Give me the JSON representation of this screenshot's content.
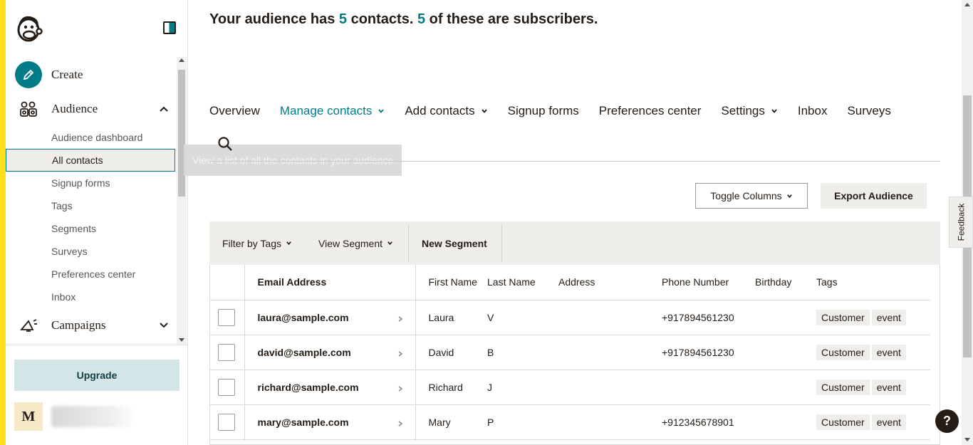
{
  "sidebar": {
    "create_label": "Create",
    "audience_label": "Audience",
    "campaigns_label": "Campaigns",
    "audience_items": [
      {
        "label": "Audience dashboard"
      },
      {
        "label": "All contacts"
      },
      {
        "label": "Signup forms"
      },
      {
        "label": "Tags"
      },
      {
        "label": "Segments"
      },
      {
        "label": "Surveys"
      },
      {
        "label": "Preferences center"
      },
      {
        "label": "Inbox"
      }
    ],
    "upgrade_label": "Upgrade",
    "account_initial": "M"
  },
  "tooltip": {
    "text": "View a list of all the contacts in your audience."
  },
  "headline": {
    "prefix": "Your audience has ",
    "contacts_count": "5",
    "middle": " contacts. ",
    "subscribers_count": "5",
    "suffix": " of these are subscribers."
  },
  "tabs": [
    {
      "label": "Overview"
    },
    {
      "label": "Manage contacts"
    },
    {
      "label": "Add contacts"
    },
    {
      "label": "Signup forms"
    },
    {
      "label": "Preferences center"
    },
    {
      "label": "Settings"
    },
    {
      "label": "Inbox"
    },
    {
      "label": "Surveys"
    }
  ],
  "toolbar": {
    "toggle_columns_label": "Toggle Columns",
    "export_label": "Export Audience",
    "filter_tags_label": "Filter by Tags",
    "view_segment_label": "View Segment",
    "new_segment_label": "New Segment"
  },
  "table": {
    "headers": {
      "email": "Email Address",
      "first": "First Name",
      "last": "Last Name",
      "address": "Address",
      "phone": "Phone Number",
      "birthday": "Birthday",
      "tags": "Tags"
    },
    "rows": [
      {
        "email": "laura@sample.com",
        "first": "Laura",
        "last": "V",
        "address": "",
        "phone": "+917894561230",
        "birthday": "",
        "tag1": "Customer",
        "tag2": "event"
      },
      {
        "email": "david@sample.com",
        "first": "David",
        "last": "B",
        "address": "",
        "phone": "+917894561230",
        "birthday": "",
        "tag1": "Customer",
        "tag2": "event"
      },
      {
        "email": "richard@sample.com",
        "first": "Richard",
        "last": "J",
        "address": "",
        "phone": "",
        "birthday": "",
        "tag1": "Customer",
        "tag2": "event"
      },
      {
        "email": "mary@sample.com",
        "first": "Mary",
        "last": "P",
        "address": "",
        "phone": "+912345678901",
        "birthday": "",
        "tag1": "Customer",
        "tag2": "event"
      }
    ]
  },
  "feedback_label": "Feedback",
  "help_label": "?",
  "colors": {
    "accent": "#007c89",
    "brand_yellow": "#ffe01b",
    "text": "#241c15",
    "panel": "#efeeea"
  }
}
